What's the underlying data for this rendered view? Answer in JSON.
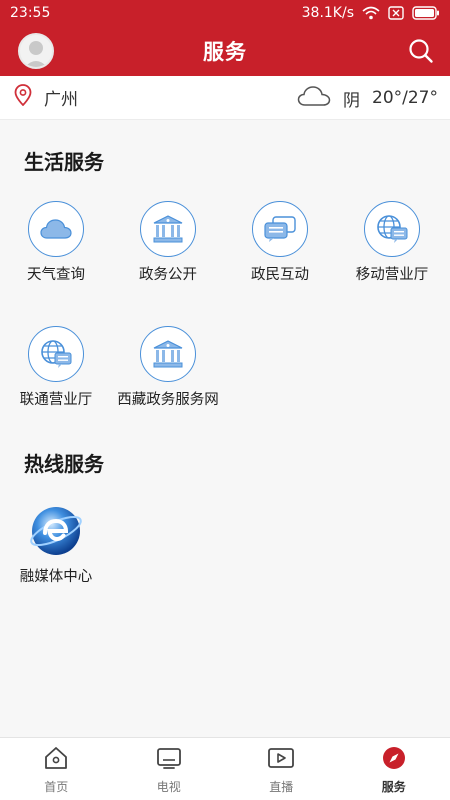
{
  "status": {
    "time": "23:55",
    "speed": "38.1K/s"
  },
  "header": {
    "title": "服务"
  },
  "location": {
    "city": "广州"
  },
  "weather": {
    "condition": "阴",
    "temp": "20°/27°"
  },
  "sections": {
    "life": {
      "title": "生活服务",
      "items": [
        {
          "label": "天气查询",
          "icon": "cloud-icon"
        },
        {
          "label": "政务公开",
          "icon": "government-building-icon"
        },
        {
          "label": "政民互动",
          "icon": "chat-bubbles-icon"
        },
        {
          "label": "移动营业厅",
          "icon": "globe-chat-icon"
        },
        {
          "label": "联通营业厅",
          "icon": "globe-chat-icon"
        },
        {
          "label": "西藏政务服务网",
          "icon": "government-building-icon"
        }
      ]
    },
    "hotline": {
      "title": "热线服务",
      "items": [
        {
          "label": "融媒体中心",
          "icon": "browser-e-icon"
        }
      ]
    }
  },
  "tabbar": {
    "items": [
      {
        "label": "首页",
        "icon": "home-icon"
      },
      {
        "label": "电视",
        "icon": "tv-icon"
      },
      {
        "label": "直播",
        "icon": "live-video-icon"
      },
      {
        "label": "服务",
        "icon": "compass-icon"
      }
    ],
    "active": "服务"
  },
  "colors": {
    "brand": "#c8202a",
    "icon_blue": "#4a90d9",
    "icon_fill": "#8cb8e8"
  }
}
